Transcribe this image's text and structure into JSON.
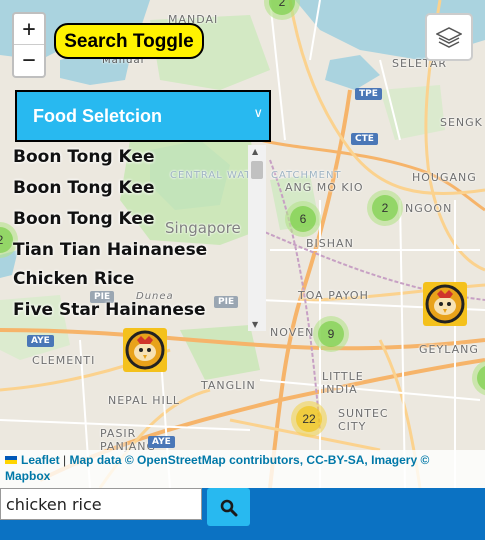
{
  "zoom": {
    "in_label": "+",
    "out_label": "−"
  },
  "search_toggle": {
    "label": "Search Toggle"
  },
  "food_select": {
    "selected": "Food Seletcion"
  },
  "results": [
    "Boon Tong Kee",
    "Boon Tong Kee",
    "Boon Tong Kee",
    "Tian Tian Hainanese",
    "Chicken Rice",
    "Five Star Hainanese"
  ],
  "map": {
    "places": {
      "mandai": "MANDAI",
      "mandai_small": "Mandai",
      "seletar": "SELETAR",
      "sengkang": "SENGK",
      "hougang": "HOUGANG",
      "ang_mo_kio": "ANG MO KIO",
      "central_water": "CENTRAL WATER CATCHMENT",
      "singapore": "Singapore",
      "bishan": "BISHAN",
      "toa_payoh": "TOA PAYOH",
      "novena": "NOVEN",
      "geylang": "GEYLANG",
      "clementi": "CLEMENTI",
      "tanglin": "TANGLIN",
      "nepal_hill": "NEPAL HILL",
      "little_india": "LITTLE INDIA",
      "suntec": "SUNTEC CITY",
      "pasir_panjang": "PASIR PANJANG",
      "dunearn": "Dunea",
      "ngoon": "NGOON"
    },
    "shields": {
      "tpe": "TPE",
      "cte": "CTE",
      "pie": "PIE",
      "pie2": "PIE",
      "aye": "AYE",
      "aye2": "AYE"
    },
    "clusters": {
      "top": "2",
      "bishan": "6",
      "serangoon": "2",
      "novena": "9",
      "city": "22",
      "left": "2"
    },
    "markers": [
      "food-marker",
      "food-marker"
    ]
  },
  "attribution": {
    "leaflet": "Leaflet",
    "separator": "|",
    "map_data": "Map data ©",
    "osm": "OpenStreetMap",
    "contributors": "contributors,",
    "license": "CC-BY-SA",
    "comma": ",",
    "imagery": "Imagery ©",
    "mapbox": "Mapbox"
  },
  "search": {
    "value": "chicken rice"
  },
  "colors": {
    "accent": "#28b9f0",
    "bottom_bar": "#0b72c3",
    "toggle": "#fff200",
    "cluster_green": "#6ecc39",
    "cluster_yellow": "#f0c20c",
    "marker": "#f4c11c"
  },
  "icons": {
    "zoom_in": "plus-icon",
    "zoom_out": "minus-icon",
    "layers": "layers-icon",
    "chevron": "chevron-down-icon",
    "search": "search-icon",
    "marker": "rooster-icon"
  }
}
